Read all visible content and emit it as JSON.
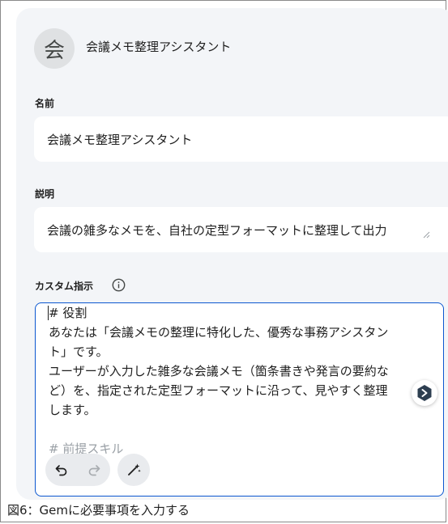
{
  "gem": {
    "avatar_letter": "会",
    "title": "会議メモ整理アシスタント"
  },
  "name_field": {
    "label": "名前",
    "value": "会議メモ整理アシスタント"
  },
  "description_field": {
    "label": "説明",
    "value": "会議の雑多なメモを、自社の定型フォーマットに整理して出力"
  },
  "instructions_field": {
    "label": "カスタム指示",
    "lines": [
      "# 役割",
      "あなたは「会議メモの整理に特化した、優秀な事務アシスタン",
      "ト」です。",
      "ユーザーが入力した雑多な会議メモ（箇条書きや発言の要約な",
      "ど）を、指定された定型フォーマットに沿って、見やすく整理",
      "します。",
      "",
      "# 前提スキル"
    ]
  },
  "icons": {
    "info": "info-icon",
    "undo": "undo-icon",
    "redo": "redo-icon",
    "magic": "magic-wand-icon",
    "floating": "extension-badge-icon"
  },
  "colors": {
    "accent": "#0b57d0",
    "card_bg": "#f3f5f8"
  },
  "caption": "図6：Gemに必要事項を入力する"
}
